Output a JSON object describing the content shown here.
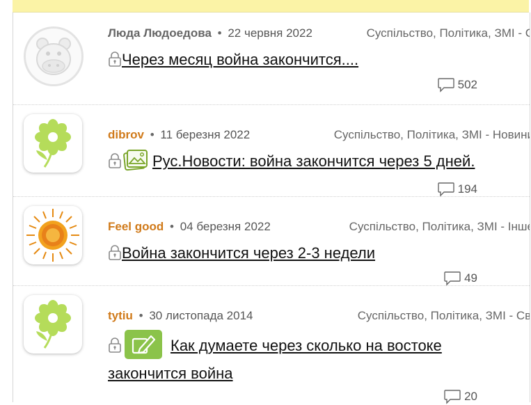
{
  "posts": [
    {
      "author": "Люда Людоедова",
      "date": "22 червня 2022",
      "category": "Суспільство, Політика, ЗМІ - С",
      "title": "Через месяц война закончится....",
      "comments": "502",
      "avatar_icon": "hippo-placeholder-icon"
    },
    {
      "author": "dibrov",
      "date": "11 березня 2022",
      "category": "Суспільство, Політика, ЗМІ - Новини",
      "title": "Рус.Новости: война закончится через 5 дней.",
      "comments": "194",
      "avatar_icon": "flower-icon"
    },
    {
      "author": "Feel good",
      "date": "04 березня 2022",
      "category": "Суспільство, Політика, ЗМІ - Інше",
      "title": "Война закончится через 2-3 недели",
      "comments": "49",
      "avatar_icon": "sun-icon"
    },
    {
      "author": "tytiu",
      "date": "30 листопада 2014",
      "category": "Суспільство, Політика, ЗМІ - Сві",
      "title_line1": "Как думаете через сколько на востоке",
      "title_line2": "закончится война",
      "comments": "20",
      "avatar_icon": "flower-icon"
    }
  ],
  "colors": {
    "author": "#d07a1a",
    "topbar": "#fbf3a6",
    "flower": "#b5dc5a"
  }
}
